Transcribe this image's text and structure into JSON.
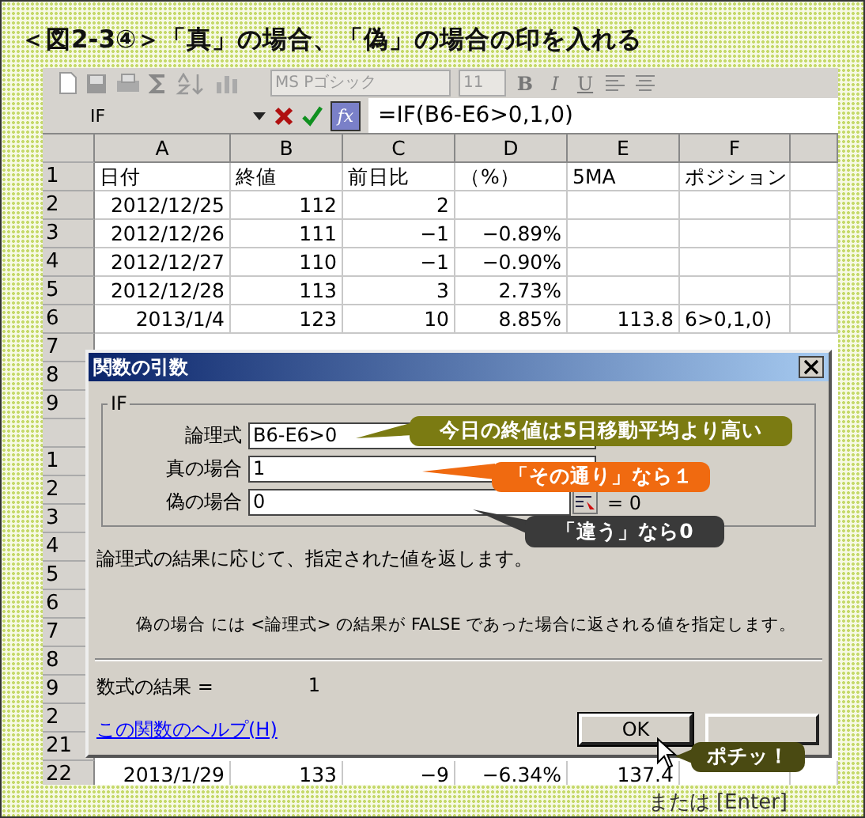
{
  "title": "＜図2-3④＞「真」の場合、「偽」の場合の印を入れる",
  "toolbar": {
    "font": "MS Pゴシック",
    "size": "11",
    "bold": "B",
    "italic": "I",
    "underline": "U"
  },
  "formula_bar": {
    "name_box": "IF",
    "fx_button": "fx",
    "formula": "=IF(B6-E6>0,1,0)"
  },
  "sheet": {
    "columns": [
      "A",
      "B",
      "C",
      "D",
      "E",
      "F"
    ],
    "rows": [
      {
        "number": "1",
        "cells": [
          "日付",
          "終値",
          "前日比",
          "（%）",
          "5MA",
          "ポジション"
        ]
      },
      {
        "number": "2",
        "cells": [
          "2012/12/25",
          "112",
          "2",
          "",
          "",
          ""
        ]
      },
      {
        "number": "3",
        "cells": [
          "2012/12/26",
          "111",
          "−1",
          "−0.89%",
          "",
          ""
        ]
      },
      {
        "number": "4",
        "cells": [
          "2012/12/27",
          "110",
          "−1",
          "−0.90%",
          "",
          ""
        ]
      },
      {
        "number": "5",
        "cells": [
          "2012/12/28",
          "113",
          "3",
          "2.73%",
          "",
          ""
        ]
      },
      {
        "number": "6",
        "cells": [
          "2013/1/4",
          "123",
          "10",
          "8.85%",
          "113.8",
          "6>0,1,0)"
        ]
      },
      {
        "number": "7"
      },
      {
        "number": "8"
      },
      {
        "number": "9"
      },
      {},
      {
        "number": "1"
      },
      {
        "number": "2"
      },
      {
        "number": "3"
      },
      {
        "number": "4"
      },
      {
        "number": "5"
      },
      {
        "number": "6"
      },
      {
        "number": "7"
      },
      {
        "number": "8"
      },
      {
        "number": "9"
      },
      {
        "number": "2"
      },
      {
        "number": "21"
      },
      {
        "number": "22",
        "cells": [
          "2013/1/29",
          "133",
          "−9",
          "−6.34%",
          "137.4",
          ""
        ]
      }
    ]
  },
  "dialog": {
    "title": "関数の引数",
    "group": "IF",
    "fields": [
      {
        "label": "論理式",
        "value": "B6-E6>0"
      },
      {
        "label": "真の場合",
        "value": "1"
      },
      {
        "label": "偽の場合",
        "value": "0",
        "result": "= 0"
      }
    ],
    "description": "論理式の結果に応じて、指定された値を返します。",
    "argument_help": "偽の場合 には <論理式> の結果が FALSE であった場合に返される値を指定します。",
    "result_label": "数式の結果 =",
    "result_value": "1",
    "help_link": "この関数のヘルプ(H)",
    "buttons": [
      "OK"
    ]
  },
  "callouts": [
    {
      "text": "今日の終値は5日移動平均より高い",
      "color": "#7b7b12"
    },
    {
      "text": "「その通り」なら１",
      "color": "#f06a10"
    },
    {
      "text": "「違う」なら0",
      "color": "#3a3a3a"
    },
    {
      "text": "ポチッ！",
      "color": "#4a4a12"
    }
  ],
  "footer_note": "または [Enter]"
}
